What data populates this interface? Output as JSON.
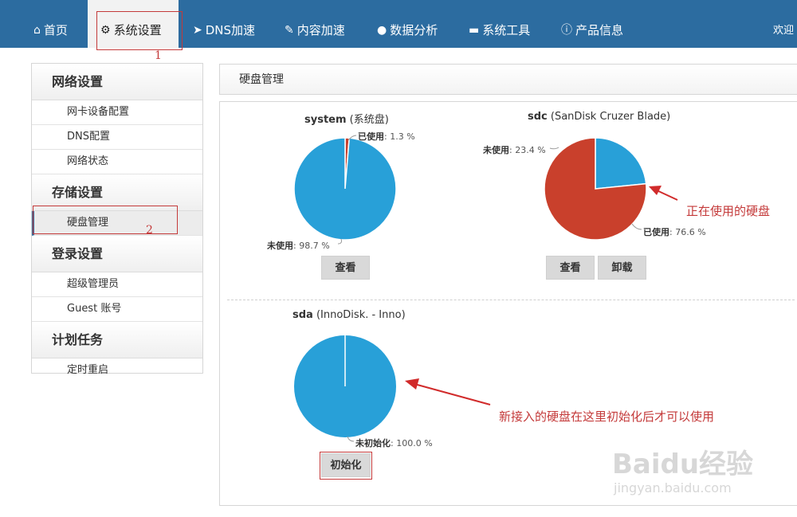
{
  "nav": {
    "items": [
      {
        "label": "首页",
        "icon": "home-icon"
      },
      {
        "label": "系统设置",
        "icon": "gears-icon"
      },
      {
        "label": "DNS加速",
        "icon": "send-icon"
      },
      {
        "label": "内容加速",
        "icon": "edit-icon"
      },
      {
        "label": "数据分析",
        "icon": "analytics-icon"
      },
      {
        "label": "系统工具",
        "icon": "toolbox-icon"
      },
      {
        "label": "产品信息",
        "icon": "info-icon"
      }
    ],
    "welcome": "欢迎",
    "active_index": 1
  },
  "sidebar": {
    "groups": [
      {
        "title": "网络设置",
        "items": [
          "网卡设备配置",
          "DNS配置",
          "网络状态"
        ]
      },
      {
        "title": "存储设置",
        "items": [
          "硬盘管理"
        ]
      },
      {
        "title": "登录设置",
        "items": [
          "超级管理员",
          "Guest 账号"
        ]
      },
      {
        "title": "计划任务",
        "items": [
          "定时重启"
        ]
      }
    ],
    "active_item": "硬盘管理"
  },
  "main": {
    "title": "硬盘管理",
    "disks": [
      {
        "name": "system",
        "desc": " (系统盘)",
        "slices": [
          {
            "label": "已使用",
            "value": 1.3,
            "color": "#c9402c",
            "pct_text": ": 1.3 %"
          },
          {
            "label": "未使用",
            "value": 98.7,
            "color": "#28a0d8",
            "pct_text": ": 98.7 %"
          }
        ],
        "buttons": [
          "查看"
        ]
      },
      {
        "name": "sdc",
        "desc": " (SanDisk Cruzer Blade)",
        "slices": [
          {
            "label": "未使用",
            "value": 23.4,
            "color": "#28a0d8",
            "pct_text": ": 23.4 %"
          },
          {
            "label": "已使用",
            "value": 76.6,
            "color": "#c9402c",
            "pct_text": ": 76.6 %"
          }
        ],
        "buttons": [
          "查看",
          "卸载"
        ]
      },
      {
        "name": "sda",
        "desc": " (InnoDisk. - Inno)",
        "slices": [
          {
            "label": "未初始化",
            "value": 100.0,
            "color": "#28a0d8",
            "pct_text": ": 100.0 %"
          }
        ],
        "buttons": [
          "初始化"
        ]
      }
    ]
  },
  "annotations": {
    "marker1": "1",
    "marker2": "2",
    "in_use": "正在使用的硬盘",
    "new_disk": "新接入的硬盘在这里初始化后才可以使用"
  },
  "watermark": {
    "brand": "Baidu经验",
    "url": "jingyan.baidu.com"
  }
}
